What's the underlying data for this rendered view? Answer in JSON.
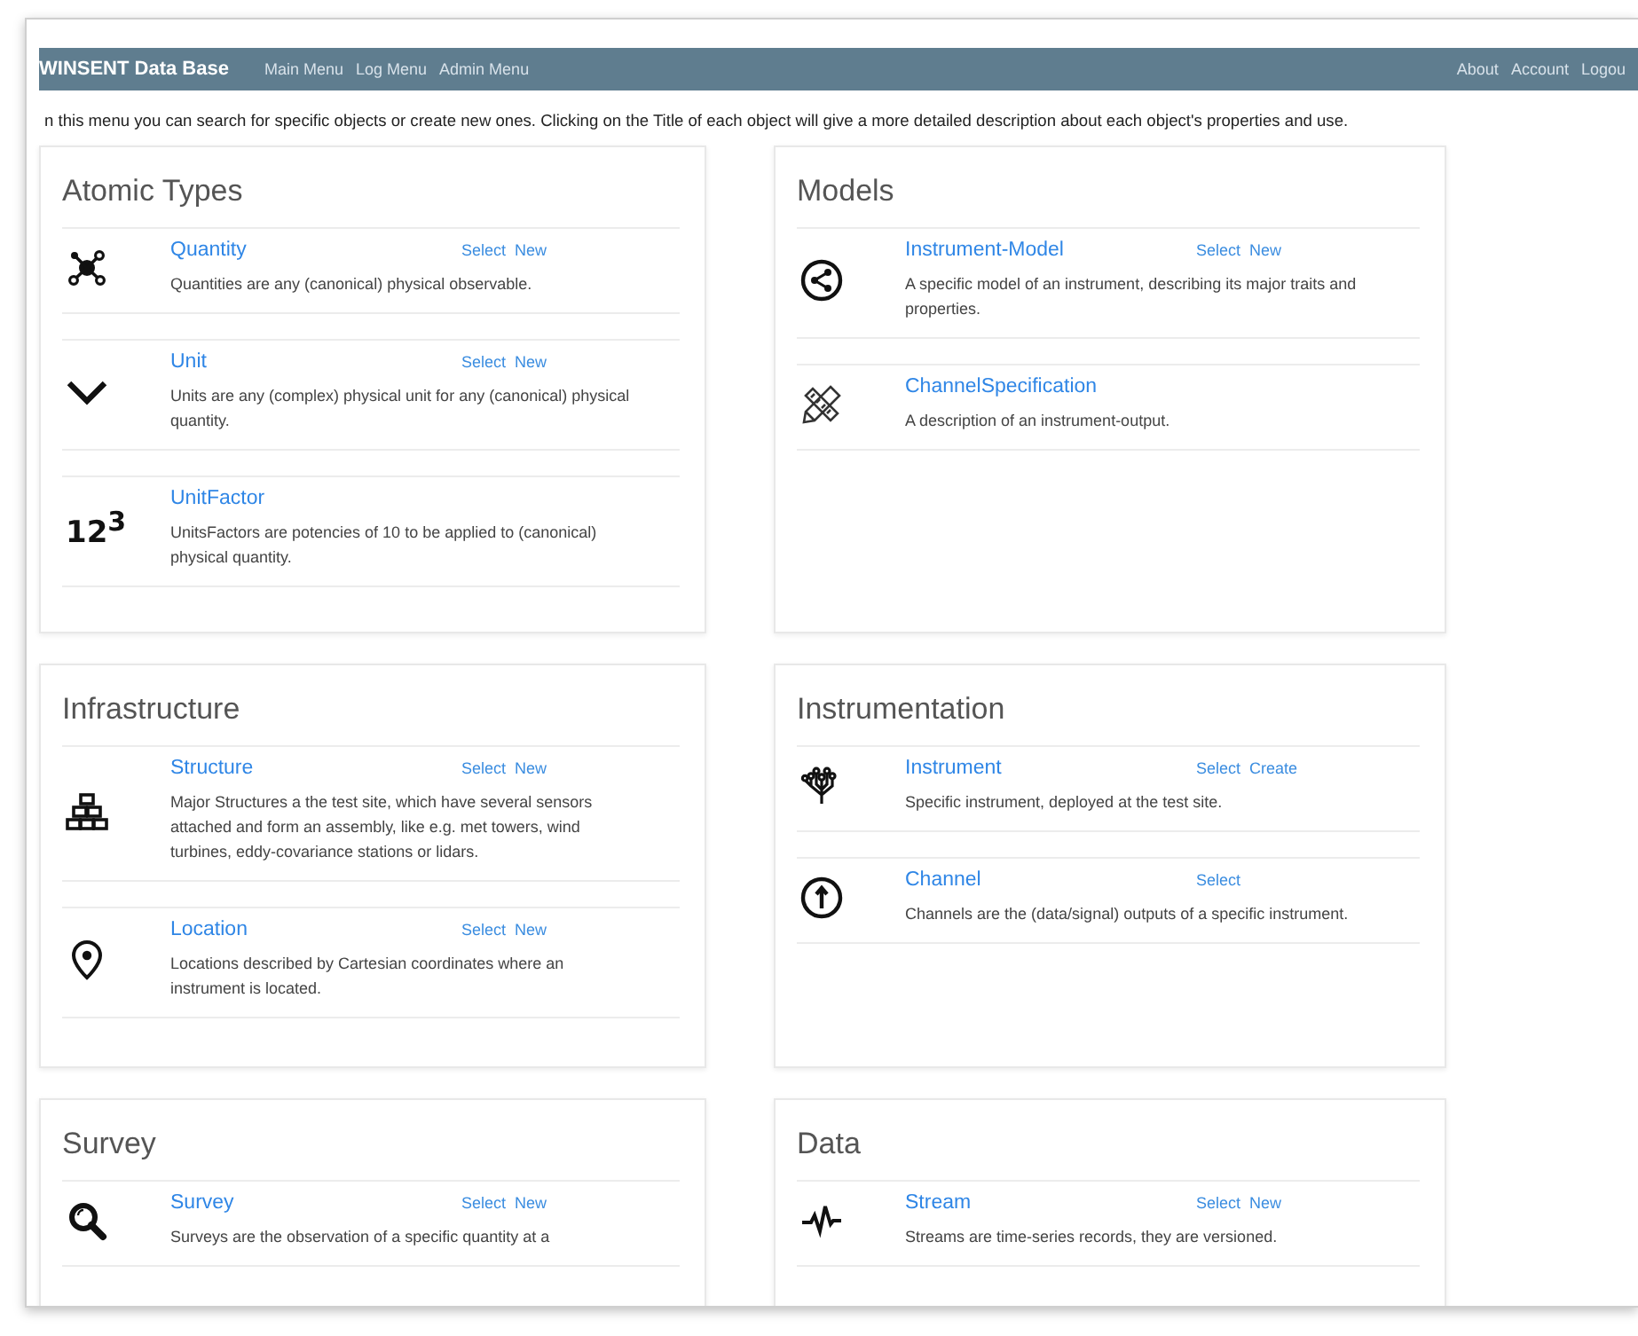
{
  "navbar": {
    "brand": "WINSENT Data Base",
    "menu": [
      "Main Menu",
      "Log Menu",
      "Admin Menu"
    ],
    "right_menu": [
      "About",
      "Account",
      "Logou"
    ]
  },
  "intro": "n this menu you can search for specific objects or create new ones. Clicking on the Title of each object will give a more detailed description about each object's properties and use.",
  "sections": [
    {
      "title": "Atomic Types",
      "items": [
        {
          "title": "Quantity",
          "actions": [
            "Select",
            "New"
          ],
          "description": "Quantities are any (canonical) physical observable."
        },
        {
          "title": "Unit",
          "actions": [
            "Select",
            "New"
          ],
          "description": "Units are any (complex) physical unit for any (canonical) physical quantity."
        },
        {
          "title": "UnitFactor",
          "icon_text": "12$^{3}$",
          "description": "UnitsFactors are potencies of 10 to be applied to (canonical) physical quantity."
        }
      ]
    },
    {
      "title": "Models",
      "items": [
        {
          "title": "Instrument-Model",
          "actions": [
            "Select",
            "New"
          ],
          "description": "A specific model of an instrument, describing its major traits and properties."
        },
        {
          "title": "ChannelSpecification",
          "description": "A description of an instrument-output."
        }
      ]
    },
    {
      "title": "Infrastructure",
      "items": [
        {
          "title": "Structure",
          "actions": [
            "Select",
            "New"
          ],
          "description": "Major Structures a the test site, which have several sensors attached and form an assembly, like e.g. met towers, wind turbines, eddy-covariance stations or lidars."
        },
        {
          "title": "Location",
          "actions": [
            "Select",
            "New"
          ],
          "description": "Locations described by Cartesian coordinates where an instrument is located."
        }
      ]
    },
    {
      "title": "Instrumentation",
      "items": [
        {
          "title": "Instrument",
          "actions": [
            "Select",
            "Create"
          ],
          "description": "Specific instrument, deployed at the test site."
        },
        {
          "title": "Channel",
          "actions": [
            "Select"
          ],
          "description": "Channels are the (data/signal) outputs of a specific instrument."
        }
      ]
    },
    {
      "title": "Survey",
      "items": [
        {
          "title": "Survey",
          "actions": [
            "Select",
            "New"
          ],
          "description": "Surveys are the observation of a specific quantity at a"
        }
      ]
    },
    {
      "title": "Data",
      "items": [
        {
          "title": "Stream",
          "actions": [
            "Select",
            "New"
          ],
          "description": "Streams are time-series records, they are versioned."
        }
      ]
    }
  ]
}
